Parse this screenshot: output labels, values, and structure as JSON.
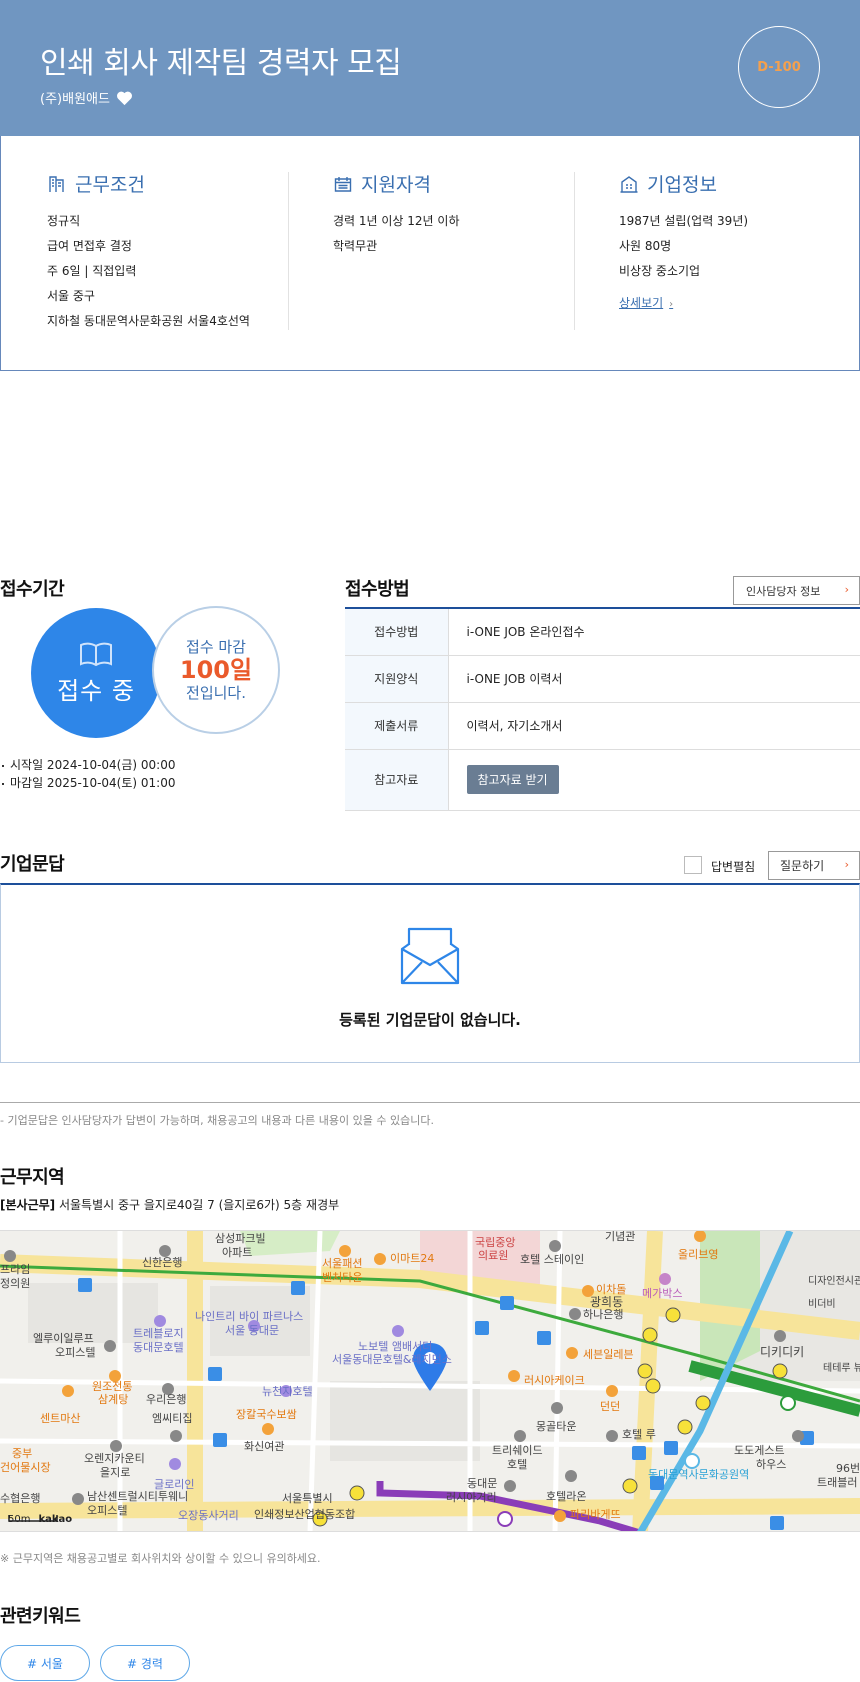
{
  "header": {
    "title": "인쇄 회사 제작팀 경력자 모집",
    "company": "(주)배원애드",
    "dday": "D-100"
  },
  "summary": {
    "work": {
      "title": "근무조건",
      "items": [
        "정규직",
        "급여 면접후 결정",
        "주 6일 | 직접입력",
        "서울 중구",
        "지하철 동대문역사문화공원 서울4호선역"
      ]
    },
    "qual": {
      "title": "지원자격",
      "items": [
        "경력 1년 이상 12년 이하",
        "학력무관"
      ]
    },
    "corp": {
      "title": "기업정보",
      "items": [
        "1987년 설립(업력 39년)",
        "사원 80명",
        "비상장 중소기업"
      ],
      "detail_link": "상세보기"
    }
  },
  "period": {
    "title": "접수기간",
    "status": "접수 중",
    "deadline_l1": "접수 마감",
    "deadline_days": "100일",
    "deadline_l3": "전입니다.",
    "start": "시작일 2024-10-04(금) 00:00",
    "end": "마감일 2025-10-04(토) 01:00"
  },
  "method": {
    "title": "접수방법",
    "hr_button": "인사담당자 정보",
    "rows": [
      {
        "key": "접수방법",
        "value": "i-ONE JOB 온라인접수"
      },
      {
        "key": "지원양식",
        "value": "i-ONE JOB 이력서"
      },
      {
        "key": "제출서류",
        "value": "이력서, 자기소개서"
      },
      {
        "key": "참고자료",
        "value": "참고자료 받기"
      }
    ]
  },
  "qa": {
    "title": "기업문답",
    "toggle_label": "답변펼침",
    "ask_button": "질문하기",
    "empty": "등록된 기업문답이 없습니다.",
    "note": "- 기업문답은 인사담당자가 답변이 가능하며, 채용공고의 내용과 다른 내용이 있을 수 있습니다."
  },
  "location": {
    "title": "근무지역",
    "tag": "[본사근무]",
    "address": "서울특별시 중구 을지로40길 7 (을지로6가) 5층 재경부",
    "note": "※ 근무지역은 채용공고별로 회사위치와 상이할 수 있으니 유의하세요.",
    "map_labels": [
      "삼성파크빌",
      "아파트",
      "신한은행",
      "서울패션",
      "벤처타운",
      "이마트24",
      "국립중앙",
      "의료원",
      "호텔 스테이인",
      "올리브영",
      "기념관",
      "이차돌",
      "광희동",
      "하나은행",
      "메가박스",
      "디자인전시관",
      "비더비",
      "정의원",
      "엘루이일루프",
      "오피스텔",
      "트레블로지",
      "동대문호텔",
      "나인트리 바이 파르나스",
      "서울 동대문",
      "노보텔 앰배서더",
      "서울동대문호텔&레지던스",
      "디키디키",
      "테테루 뷰",
      "원조전통",
      "삼계탕",
      "우리은행",
      "뉴천지호텔",
      "센트마산",
      "엠씨티집",
      "장칼국수보쌈",
      "러시아케이크",
      "세븐일레븐",
      "던던",
      "몽골타운",
      "호텔 루",
      "동대문역사문화공원역",
      "중부",
      "건어물시장",
      "오렌지카운티",
      "을지로",
      "화신여관",
      "트리쉐이드",
      "호텔",
      "도도게스트",
      "하우스",
      "96번",
      "트래블러",
      "수협은행",
      "남산센트럴시티투웨니",
      "오피스텔",
      "글로리인",
      "서울특별시",
      "오장동사거리",
      "인쇄정보산업협동조합",
      "동대문",
      "러시아거리",
      "호텔라온",
      "파리바게뜨",
      "프라임"
    ],
    "map_scale": "50m",
    "map_brand": "kakao"
  },
  "keywords": {
    "title": "관련키워드",
    "items": [
      "# 서울",
      "# 경력"
    ]
  }
}
